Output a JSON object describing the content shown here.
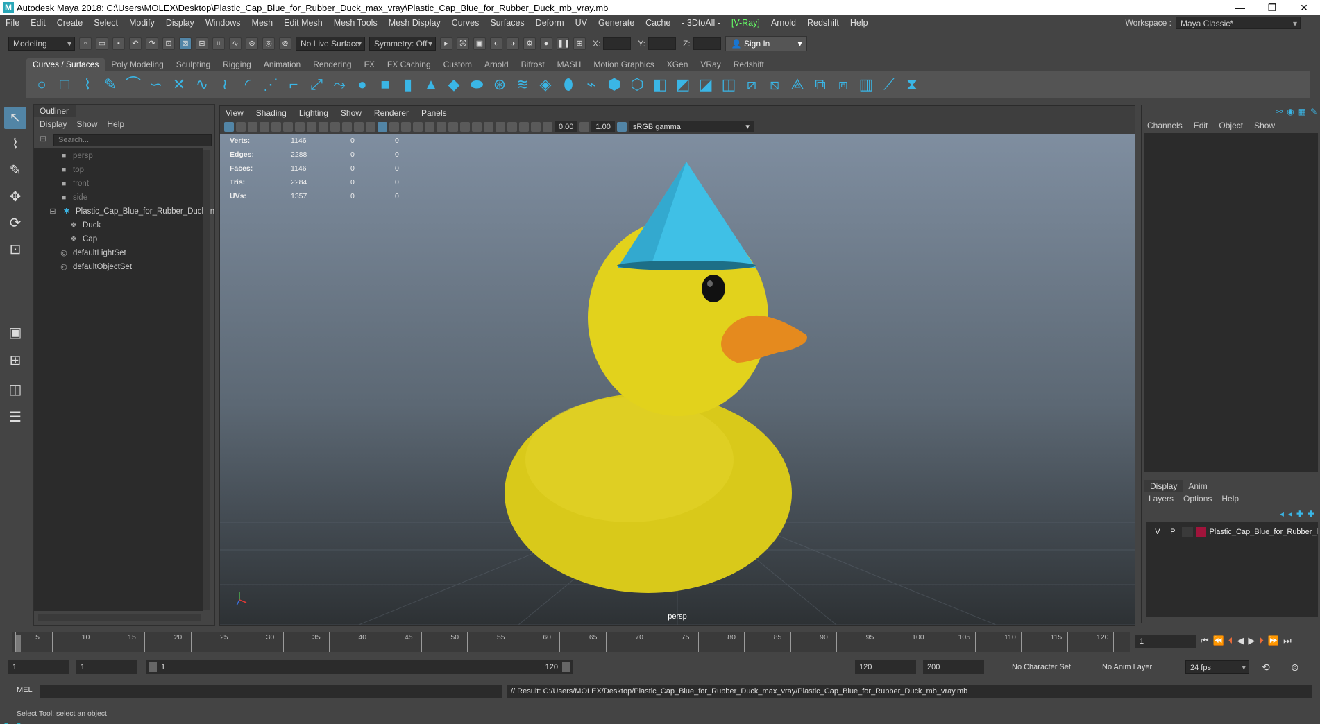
{
  "window": {
    "title": "Autodesk Maya 2018: C:\\Users\\MOLEX\\Desktop\\Plastic_Cap_Blue_for_Rubber_Duck_max_vray\\Plastic_Cap_Blue_for_Rubber_Duck_mb_vray.mb",
    "app_icon_letter": "M",
    "minimize": "—",
    "restore": "❐",
    "close": "✕"
  },
  "menubar": {
    "items": [
      "File",
      "Edit",
      "Create",
      "Select",
      "Modify",
      "Display",
      "Windows",
      "Mesh",
      "Edit Mesh",
      "Mesh Tools",
      "Mesh Display",
      "Curves",
      "Surfaces",
      "Deform",
      "UV",
      "Generate",
      "Cache",
      "- 3DtoAll -",
      "[V-Ray]",
      "Arnold",
      "Redshift",
      "Help"
    ],
    "workspace_label": "Workspace :",
    "workspace_value": "Maya Classic*"
  },
  "statusline": {
    "mode": "Modeling",
    "live_surface": "No Live Surface",
    "symmetry": "Symmetry: Off",
    "x_label": "X:",
    "y_label": "Y:",
    "z_label": "Z:",
    "sign_in": "Sign In"
  },
  "shelf": {
    "tabs": [
      "Curves / Surfaces",
      "Poly Modeling",
      "Sculpting",
      "Rigging",
      "Animation",
      "Rendering",
      "FX",
      "FX Caching",
      "Custom",
      "Arnold",
      "Bifrost",
      "MASH",
      "Motion Graphics",
      "XGen",
      "VRay",
      "Redshift"
    ],
    "active_tab": "Curves / Surfaces"
  },
  "outliner": {
    "tab": "Outliner",
    "menu": [
      "Display",
      "Show",
      "Help"
    ],
    "search_placeholder": "Search...",
    "items": [
      {
        "label": "persp",
        "dim": true
      },
      {
        "label": "top",
        "dim": true
      },
      {
        "label": "front",
        "dim": true
      },
      {
        "label": "side",
        "dim": true
      },
      {
        "label": "Plastic_Cap_Blue_for_Rubber_Duck_n",
        "dim": false
      },
      {
        "label": "Duck",
        "dim": false
      },
      {
        "label": "Cap",
        "dim": false
      },
      {
        "label": "defaultLightSet",
        "dim": false
      },
      {
        "label": "defaultObjectSet",
        "dim": false
      }
    ]
  },
  "viewport": {
    "menu": [
      "View",
      "Shading",
      "Lighting",
      "Show",
      "Renderer",
      "Panels"
    ],
    "exposure": "0.00",
    "gamma_value": "1.00",
    "color_space": "sRGB gamma",
    "camera": "persp",
    "hud": [
      {
        "label": "Verts:",
        "a": "1146",
        "b": "0",
        "c": "0"
      },
      {
        "label": "Edges:",
        "a": "2288",
        "b": "0",
        "c": "0"
      },
      {
        "label": "Faces:",
        "a": "1146",
        "b": "0",
        "c": "0"
      },
      {
        "label": "Tris:",
        "a": "2284",
        "b": "0",
        "c": "0"
      },
      {
        "label": "UVs:",
        "a": "1357",
        "b": "0",
        "c": "0"
      }
    ],
    "colors": {
      "duck": "#e2d21c",
      "cap": "#3fc0e6",
      "beak": "#e58a1e",
      "eye": "#111111"
    }
  },
  "channelbox": {
    "menu": [
      "Channels",
      "Edit",
      "Object",
      "Show"
    ],
    "layer_tabs": [
      "Display",
      "Anim"
    ],
    "layer_menu": [
      "Layers",
      "Options",
      "Help"
    ],
    "layer": {
      "v": "V",
      "p": "P",
      "name": "Plastic_Cap_Blue_for_Rubber_l",
      "color": "#a0143b"
    }
  },
  "timeslider": {
    "ticks": [
      "1",
      "5",
      "10",
      "15",
      "20",
      "25",
      "30",
      "35",
      "40",
      "45",
      "50",
      "55",
      "60",
      "65",
      "70",
      "75",
      "80",
      "85",
      "90",
      "95",
      "100",
      "105",
      "110",
      "115",
      "120"
    ],
    "current_frame": "1"
  },
  "rangeslider": {
    "start": "1",
    "anim_start": "1",
    "range_start": "1",
    "range_end": "120",
    "anim_end_field": "120",
    "end_field": "200",
    "character_set": "No Character Set",
    "anim_layer": "No Anim Layer",
    "fps": "24 fps"
  },
  "commandline": {
    "mel": "MEL",
    "result": "// Result: C:/Users/MOLEX/Desktop/Plastic_Cap_Blue_for_Rubber_Duck_max_vray/Plastic_Cap_Blue_for_Rubber_Duck_mb_vray.mb"
  },
  "helpline": {
    "text": "Select Tool: select an object"
  }
}
